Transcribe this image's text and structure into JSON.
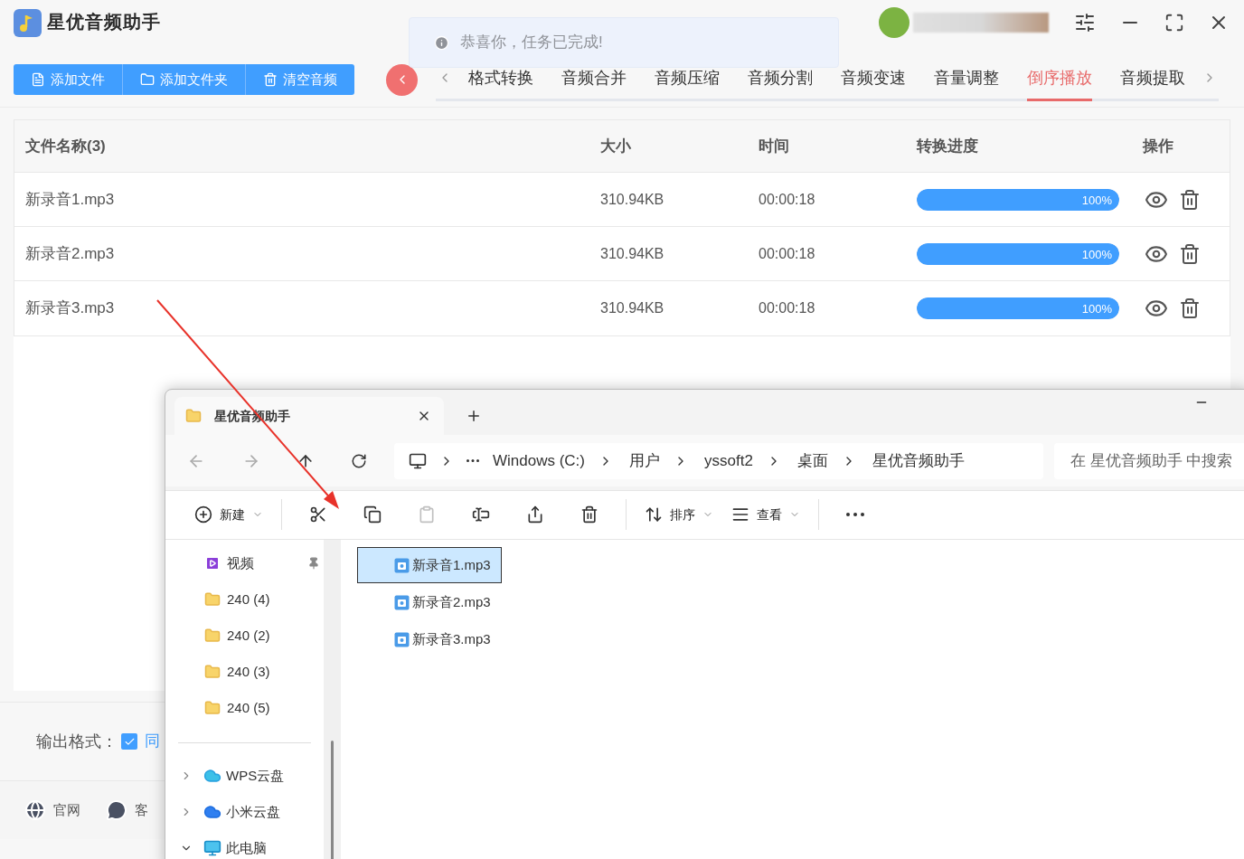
{
  "app": {
    "title": "星优音频助手",
    "toast": "恭喜你，任务已完成!",
    "actions": [
      {
        "kind": "file",
        "label": "添加文件"
      },
      {
        "kind": "folder",
        "label": "添加文件夹"
      },
      {
        "kind": "clear",
        "label": "清空音频"
      }
    ],
    "tabs": [
      {
        "label": "格式转换",
        "selected": false
      },
      {
        "label": "音频合并",
        "selected": false
      },
      {
        "label": "音频压缩",
        "selected": false
      },
      {
        "label": "音频分割",
        "selected": false
      },
      {
        "label": "音频变速",
        "selected": false
      },
      {
        "label": "音量调整",
        "selected": false
      },
      {
        "label": "倒序播放",
        "selected": true
      },
      {
        "label": "音频提取",
        "selected": false
      }
    ],
    "table": {
      "columns": [
        "文件名称(3)",
        "大小",
        "时间",
        "转换进度",
        "操作"
      ],
      "rows": [
        {
          "name": "新录音1.mp3",
          "size": "310.94KB",
          "time": "00:00:18",
          "level": 1,
          "progress": "100%"
        },
        {
          "name": "新录音2.mp3",
          "size": "310.94KB",
          "time": "00:00:18",
          "level": 1,
          "progress": "100%"
        },
        {
          "name": "新录音3.mp3",
          "size": "310.94KB",
          "time": "00:00:18",
          "level": 1,
          "progress": "100%"
        }
      ]
    },
    "output": {
      "label": "输出格式：",
      "checked": true,
      "option": "同"
    },
    "footer": [
      {
        "kind": "web",
        "label": "官网"
      },
      {
        "kind": "chat",
        "label": "客"
      }
    ]
  },
  "explorer": {
    "tab_title": "星优音频助手",
    "breadcrumb": [
      "Windows (C:)",
      "用户",
      "yssoft2",
      "桌面",
      "星优音频助手"
    ],
    "search_placeholder": "在 星优音频助手 中搜索",
    "commands": [
      {
        "kind": "new",
        "label": "新建",
        "disabled": false
      },
      {
        "kind": "cut",
        "disabled": false
      },
      {
        "kind": "copy",
        "disabled": false
      },
      {
        "kind": "paste",
        "disabled": true
      },
      {
        "kind": "rename",
        "disabled": false
      },
      {
        "kind": "share",
        "disabled": false
      },
      {
        "kind": "delete",
        "disabled": false
      },
      {
        "kind": "sort",
        "label": "排序",
        "disabled": false
      },
      {
        "kind": "view",
        "label": "查看",
        "disabled": false
      },
      {
        "kind": "more",
        "disabled": false
      }
    ],
    "quick": [
      {
        "kind": "video",
        "label": "视频",
        "pinned": true
      },
      {
        "kind": "folder",
        "label": "240 (4)",
        "pinned": false
      },
      {
        "kind": "folder",
        "label": "240 (2)",
        "pinned": false
      },
      {
        "kind": "folder",
        "label": "240 (3)",
        "pinned": false
      },
      {
        "kind": "folder",
        "label": "240 (5)",
        "pinned": false
      }
    ],
    "locations": [
      {
        "kind": "wps",
        "label": "WPS云盘",
        "expanded": false
      },
      {
        "kind": "mi",
        "label": "小米云盘",
        "expanded": false
      },
      {
        "kind": "pc",
        "label": "此电脑",
        "expanded": true
      }
    ],
    "files": [
      {
        "name": "新录音1.mp3",
        "selected": true
      },
      {
        "name": "新录音2.mp3",
        "selected": false
      },
      {
        "name": "新录音3.mp3",
        "selected": false
      }
    ]
  }
}
